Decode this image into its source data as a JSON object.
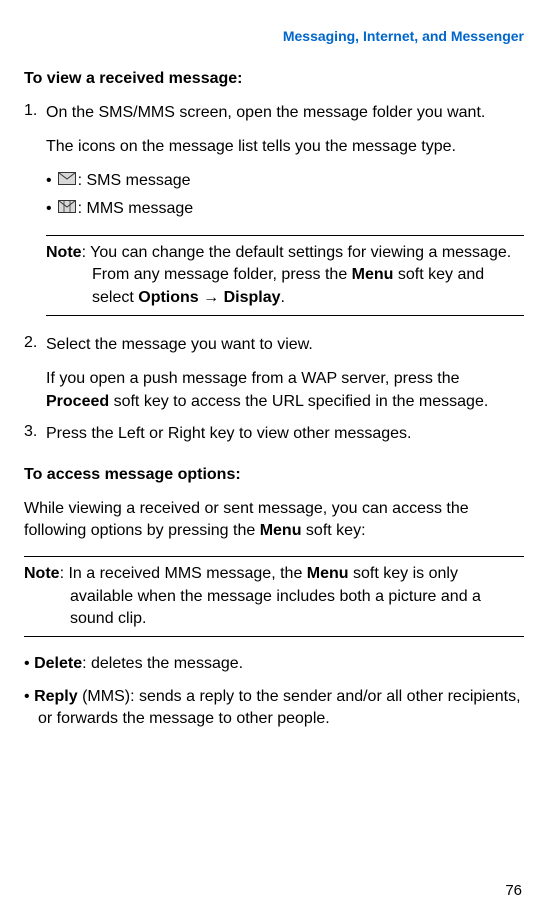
{
  "header": "Messaging, Internet, and Messenger",
  "h1": "To view a received message:",
  "step1": {
    "num": "1.",
    "text": "On the SMS/MMS screen, open the message folder you want.",
    "sub": "The icons on the message list tells you the message type.",
    "bullet1_suffix": ": SMS message",
    "bullet2_suffix": ": MMS message"
  },
  "note1": {
    "label": "Note",
    "text_a": ": You can change the default settings for viewing a message. From any message folder, press the ",
    "menu": "Menu",
    "text_b": " soft key and select ",
    "options": "Options",
    "arrow": " → ",
    "display": "Display",
    "text_c": "."
  },
  "step2": {
    "num": "2.",
    "text": "Select the message you want to view.",
    "sub_a": "If you open a push message from a WAP server, press the ",
    "proceed": "Proceed",
    "sub_b": " soft key to access the URL specified in the message."
  },
  "step3": {
    "num": "3.",
    "text": "Press the Left or Right key to view other messages."
  },
  "h2": "To access message options:",
  "intro_a": "While viewing a received or sent message, you can access the following options by pressing the ",
  "intro_menu": "Menu",
  "intro_b": " soft key:",
  "note2": {
    "label": "Note",
    "text_a": ": In a received MMS message, the ",
    "menu": "Menu",
    "text_b": " soft key is only available when the message includes both a picture and a sound clip."
  },
  "opt1": {
    "bullet": "•",
    "name": "Delete",
    "desc": ": deletes the message."
  },
  "opt2": {
    "bullet": "•",
    "name": "Reply",
    "paren": " (MMS): sends a reply to the sender and/or all other recipients, or forwards the message to other people."
  },
  "page": "76"
}
